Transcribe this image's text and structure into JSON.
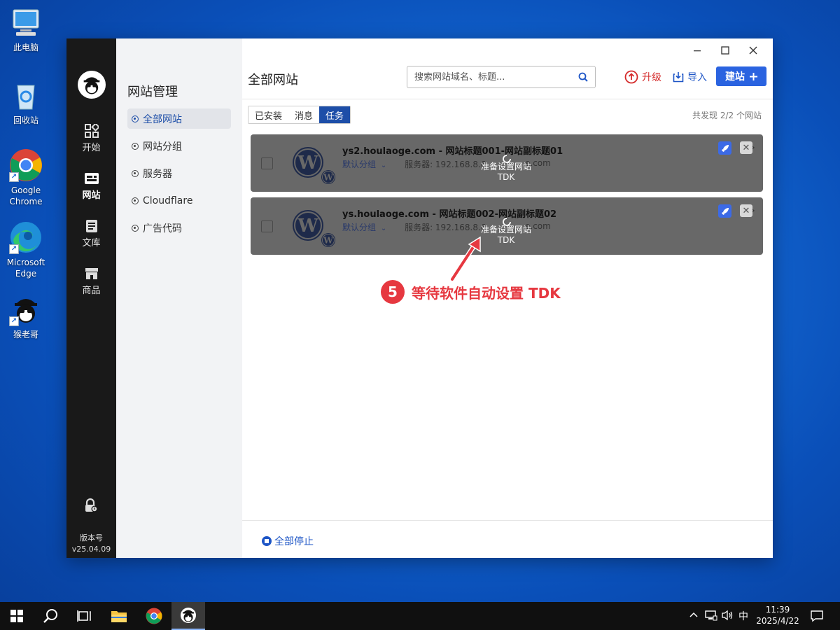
{
  "desktop": {
    "icons": [
      {
        "label": "此电脑"
      },
      {
        "label": "回收站"
      },
      {
        "label": "Google Chrome"
      },
      {
        "label": "Microsoft Edge"
      },
      {
        "label": "猴老哥"
      }
    ]
  },
  "rail": {
    "items": [
      {
        "label": "开始"
      },
      {
        "label": "网站"
      },
      {
        "label": "文库"
      },
      {
        "label": "商品"
      }
    ],
    "version_label": "版本号",
    "version_value": "v25.04.09"
  },
  "subnav": {
    "title": "网站管理",
    "items": [
      {
        "label": "全部网站",
        "active": true
      },
      {
        "label": "网站分组"
      },
      {
        "label": "服务器"
      },
      {
        "label": "Cloudflare"
      },
      {
        "label": "广告代码"
      }
    ]
  },
  "main": {
    "title": "全部网站",
    "search_placeholder": "搜索网站域名、标题...",
    "upgrade_label": "升级",
    "import_label": "导入",
    "build_label": "建站",
    "tabs": [
      {
        "label": "已安装"
      },
      {
        "label": "消息"
      },
      {
        "label": "任务",
        "active": true
      }
    ],
    "count_text": "共发现 2/2 个网站",
    "sites": [
      {
        "name": "ys2.houlaoge.com - 网站标题001-网站副标题01",
        "group": "默认分组",
        "server": "服务器: 192.168.8.6",
        "tail": "e.com",
        "status": "准备设置网站TDK"
      },
      {
        "name": "ys.houlaoge.com - 网站标题002-网站副标题02",
        "group": "默认分组",
        "server": "服务器: 192.168.8.6",
        "tail": "e.com",
        "status": "准备设置网站TDK"
      }
    ],
    "annotation_number": "5",
    "annotation_text": "等待软件自动设置 TDK",
    "stop_all_label": "全部停止"
  },
  "taskbar": {
    "ime": "中",
    "time": "11:39",
    "date": "2025/4/22"
  },
  "colors": {
    "accent": "#2a63e0",
    "active_tab": "#1d4ea8",
    "danger": "#d42a2a",
    "annotation": "#e63840",
    "row_overlay": "#686868"
  }
}
